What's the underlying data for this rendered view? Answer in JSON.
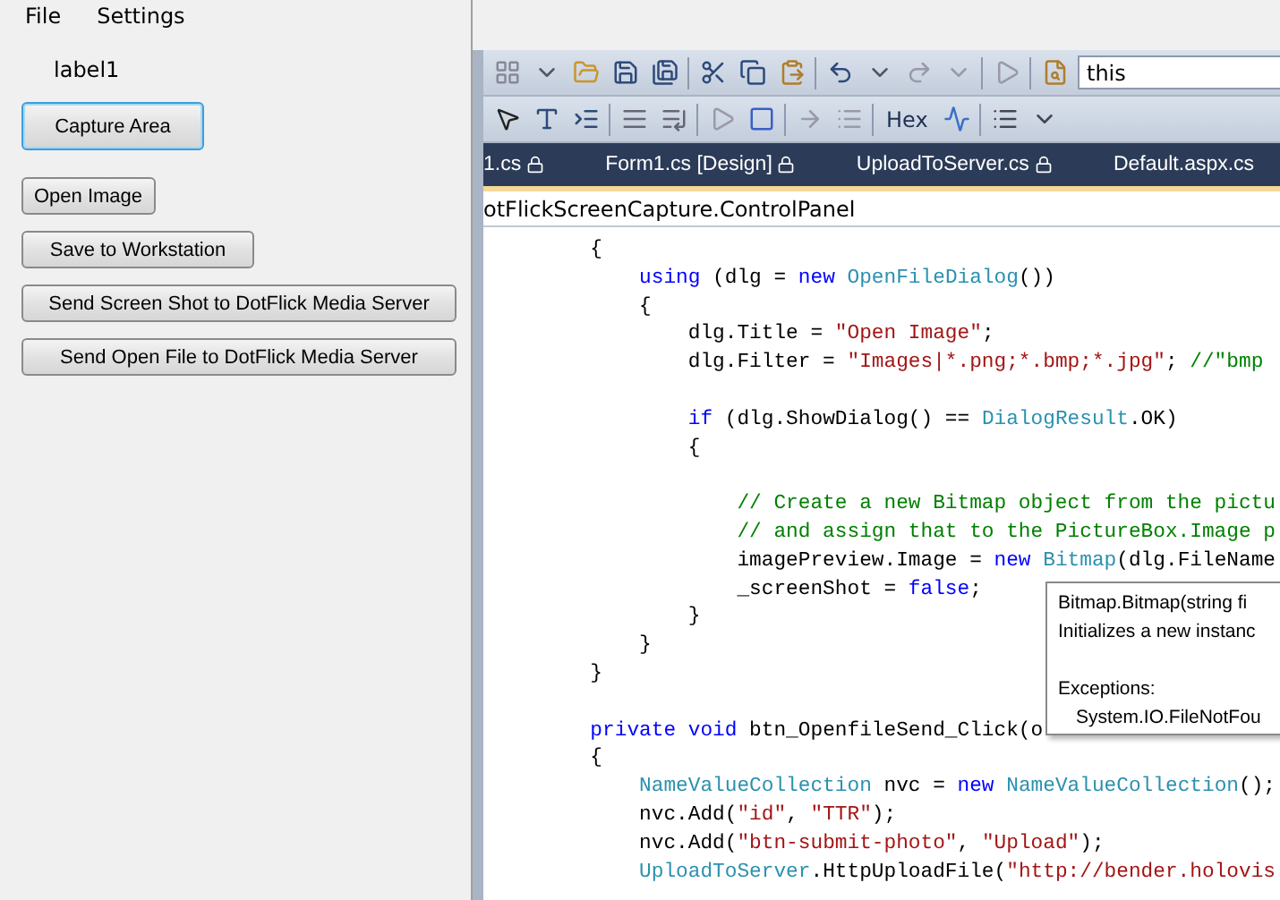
{
  "menu": [
    "File",
    "Settings"
  ],
  "label": "label1",
  "buttons": [
    {
      "label": "Capture Area",
      "focused": true
    },
    {
      "label": "Open Image",
      "focused": false
    },
    {
      "label": "Save to Workstation",
      "focused": false
    },
    {
      "label": "Send Screen Shot to DotFlick Media Server",
      "focused": false
    },
    {
      "label": "Send Open File to DotFlick Media Server",
      "focused": false
    }
  ],
  "preview": {
    "search_value": "this",
    "hex_label": "Hex",
    "tabs": [
      {
        "label": "1.cs",
        "locked": true
      },
      {
        "label": "Form1.cs [Design]",
        "locked": true
      },
      {
        "label": "UploadToServer.cs",
        "locked": true
      },
      {
        "label": "Default.aspx.cs",
        "locked": false
      }
    ],
    "breadcrumb": "otFlickScreenCapture.ControlPanel",
    "code_lines": [
      {
        "kind": "code",
        "tokens": [
          {
            "kind": "plain",
            "text": "        {"
          }
        ]
      },
      {
        "kind": "code",
        "tokens": [
          {
            "kind": "kw",
            "text": "            using"
          },
          {
            "kind": "plain",
            "text": " (dlg = "
          },
          {
            "kind": "kw",
            "text": "new"
          },
          {
            "kind": "type",
            "text": " OpenFileDialog"
          },
          {
            "kind": "plain",
            "text": "())"
          }
        ]
      },
      {
        "kind": "code",
        "tokens": [
          {
            "kind": "plain",
            "text": "            {"
          }
        ]
      },
      {
        "kind": "code",
        "tokens": [
          {
            "kind": "plain",
            "text": "                dlg.Title = "
          },
          {
            "kind": "str",
            "text": "\"Open Image\""
          },
          {
            "kind": "plain",
            "text": ";"
          }
        ]
      },
      {
        "kind": "code",
        "tokens": [
          {
            "kind": "plain",
            "text": "                dlg.Filter = "
          },
          {
            "kind": "str",
            "text": "\"Images|*.png;*.bmp;*.jpg\""
          },
          {
            "kind": "plain",
            "text": "; "
          },
          {
            "kind": "comment",
            "text": "//\"bmp"
          }
        ]
      },
      {
        "kind": "blank"
      },
      {
        "kind": "code",
        "tokens": [
          {
            "kind": "kw",
            "text": "                if"
          },
          {
            "kind": "plain",
            "text": " (dlg.ShowDialog() == "
          },
          {
            "kind": "type",
            "text": "DialogResult"
          },
          {
            "kind": "plain",
            "text": ".OK)"
          }
        ]
      },
      {
        "kind": "code",
        "tokens": [
          {
            "kind": "plain",
            "text": "                {"
          }
        ]
      },
      {
        "kind": "blank"
      },
      {
        "kind": "code",
        "tokens": [
          {
            "kind": "comment",
            "text": "                    // Create a new Bitmap object from the pictu"
          }
        ]
      },
      {
        "kind": "code",
        "tokens": [
          {
            "kind": "comment",
            "text": "                    // and assign that to the PictureBox.Image p"
          }
        ]
      },
      {
        "kind": "code",
        "tokens": [
          {
            "kind": "plain",
            "text": "                    imagePreview.Image = "
          },
          {
            "kind": "kw",
            "text": "new"
          },
          {
            "kind": "type",
            "text": " Bitmap"
          },
          {
            "kind": "plain",
            "text": "(dlg.FileName"
          }
        ]
      },
      {
        "kind": "code",
        "tokens": [
          {
            "kind": "plain",
            "text": "                    _screenShot = "
          },
          {
            "kind": "kw",
            "text": "false"
          },
          {
            "kind": "plain",
            "text": ";"
          }
        ]
      },
      {
        "kind": "code",
        "tokens": [
          {
            "kind": "plain",
            "text": "                }"
          }
        ]
      },
      {
        "kind": "code",
        "tokens": [
          {
            "kind": "plain",
            "text": "            }"
          }
        ]
      },
      {
        "kind": "code",
        "tokens": [
          {
            "kind": "plain",
            "text": "        }"
          }
        ]
      },
      {
        "kind": "blank"
      },
      {
        "kind": "code",
        "tokens": [
          {
            "kind": "kw",
            "text": "        private void"
          },
          {
            "kind": "plain",
            "text": " btn_OpenfileSend_Click(o"
          }
        ]
      },
      {
        "kind": "code",
        "tokens": [
          {
            "kind": "plain",
            "text": "        {"
          }
        ]
      },
      {
        "kind": "code",
        "tokens": [
          {
            "kind": "type",
            "text": "            NameValueCollection"
          },
          {
            "kind": "plain",
            "text": " nvc = "
          },
          {
            "kind": "kw",
            "text": "new"
          },
          {
            "kind": "type",
            "text": " NameValueCollection"
          },
          {
            "kind": "plain",
            "text": "();"
          }
        ]
      },
      {
        "kind": "code",
        "tokens": [
          {
            "kind": "plain",
            "text": "            nvc.Add("
          },
          {
            "kind": "str",
            "text": "\"id\""
          },
          {
            "kind": "plain",
            "text": ", "
          },
          {
            "kind": "str",
            "text": "\"TTR\""
          },
          {
            "kind": "plain",
            "text": ");"
          }
        ]
      },
      {
        "kind": "code",
        "tokens": [
          {
            "kind": "plain",
            "text": "            nvc.Add("
          },
          {
            "kind": "str",
            "text": "\"btn-submit-photo\""
          },
          {
            "kind": "plain",
            "text": ", "
          },
          {
            "kind": "str",
            "text": "\"Upload\""
          },
          {
            "kind": "plain",
            "text": ");"
          }
        ]
      },
      {
        "kind": "code",
        "tokens": [
          {
            "kind": "type",
            "text": "            UploadToServer"
          },
          {
            "kind": "plain",
            "text": ".HttpUploadFile("
          },
          {
            "kind": "str",
            "text": "\"http://bender.holovis"
          }
        ]
      }
    ],
    "tooltip": {
      "signature": "Bitmap.Bitmap(string fi",
      "summary": "Initializes a new instanc",
      "exceptions_label": "Exceptions:",
      "exception": "System.IO.FileNotFou"
    }
  }
}
